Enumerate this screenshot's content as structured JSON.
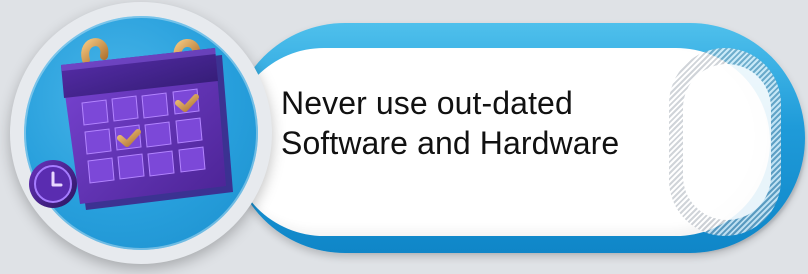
{
  "banner": {
    "text_line_1": "Never use out-dated",
    "text_line_2": "Software and Hardware"
  },
  "colors": {
    "background": "#dfe2e6",
    "pill_blue": "#1f9bd9",
    "circle_blue": "#279fdc",
    "calendar_purple": "#5b2fb0",
    "calendar_gold": "#c98f43"
  },
  "icons": {
    "main_icon": "calendar-icon",
    "clock_icon": "clock-icon"
  }
}
